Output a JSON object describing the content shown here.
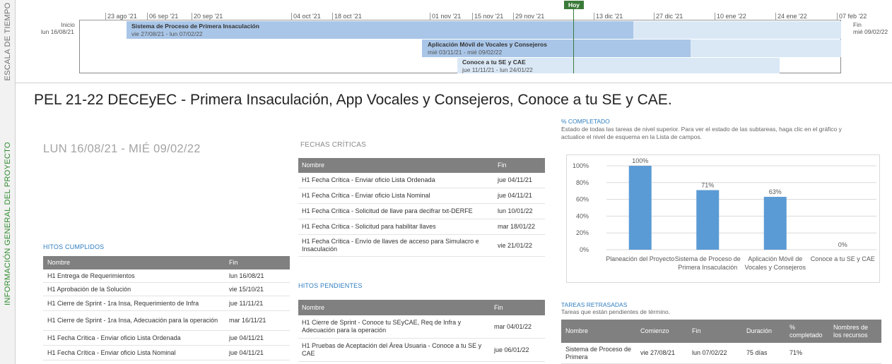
{
  "timeline": {
    "side_label": "ESCALA DE TIEMPO",
    "start": {
      "label": "Inicio",
      "date": "lun 16/08/21"
    },
    "end": {
      "label": "Fin",
      "date": "mié 09/02/22"
    },
    "today_label": "Hoy",
    "ticks": [
      "23 ago '21",
      "06 sep '21",
      "20 sep '21",
      "04 oct '21",
      "18 oct '21",
      "01 nov '21",
      "15 nov '21",
      "29 nov '21",
      "13 dic '21",
      "27 dic '21",
      "10 ene '22",
      "24 ene '22",
      "07 feb '22"
    ],
    "bars": [
      {
        "name": "Sistema de Proceso de Primera Insaculación",
        "dates": "vie 27/08/21 - lun 07/02/22",
        "progress_pct": 71
      },
      {
        "name": "Aplicación Móvil de Vocales y Consejeros",
        "dates": "mié 03/11/21 - mié 09/02/22",
        "progress_pct": 63
      },
      {
        "name": "Conoce a tu SE y CAE",
        "dates": "jue 11/11/21 - lun 24/01/22",
        "progress_pct": 0
      }
    ],
    "colors": {
      "progress": "#a9c6e8",
      "remaining": "#dae8f6",
      "today": "#3a7a38"
    }
  },
  "overview": {
    "side_label": "INFORMACIÓN GENERAL DEL PROYECTO",
    "title": "PEL 21-22 DECEyEC - Primera Insaculación, App Vocales y Consejeros, Conoce a tu SE y CAE.",
    "date_range": "LUN 16/08/21 -  MIÉ 09/02/22"
  },
  "fechas_criticas": {
    "heading": "FECHAS CRÍTICAS",
    "columns": [
      "Nombre",
      "Fin"
    ],
    "rows": [
      [
        "H1 Fecha Crítica - Enviar oficio Lista Ordenada",
        "jue 04/11/21"
      ],
      [
        "H1 Fecha Crítica - Enviar oficio Lista Nominal",
        "jue 04/11/21"
      ],
      [
        "H1 Fecha Crítica - Solicitud de llave para decifrar txt-DERFE",
        "lun 10/01/22"
      ],
      [
        "H1 Fecha Crítica - Solicitud para habilitar llaves",
        "mar 18/01/22"
      ],
      [
        "H1 Fecha Crítica - Envío de llaves de acceso para Simulacro e Insaculación",
        "vie 21/01/22"
      ]
    ]
  },
  "hitos_cumplidos": {
    "heading": "HITOS CUMPLIDOS",
    "columns": [
      "Nombre",
      "Fin"
    ],
    "rows": [
      [
        "H1 Entrega de Requerimientos",
        "lun 16/08/21"
      ],
      [
        "H1 Aprobación de la Solución",
        "vie 15/10/21"
      ],
      [
        "H1 Cierre de Sprint - 1ra Insa, Requerimiento de Infra",
        "jue 11/11/21"
      ],
      [
        "H1 Cierre de Sprint - 1ra Insa, Adecuación para la operación",
        "mar 16/11/21"
      ],
      [
        "H1 Fecha Crítica - Enviar oficio Lista Ordenada",
        "jue 04/11/21"
      ],
      [
        "H1 Fecha Crítica - Enviar oficio Lista Nominal",
        "jue 04/11/21"
      ]
    ]
  },
  "hitos_pendientes": {
    "heading": "HITOS PENDIENTES",
    "columns": [
      "Nombre",
      "Fin"
    ],
    "rows": [
      [
        "H1 Cierre de Sprint - Conoce tu SEyCAE, Req de Infra y Adecuación para la operación",
        "mar 04/01/22"
      ],
      [
        "H1 Pruebas de Aceptación del Área Usuaria - Conoce a tu SE y CAE",
        "jue 06/01/22"
      ]
    ]
  },
  "completion_chart": {
    "heading": "% COMPLETADO",
    "description": "Estado de todas las tareas de nivel superior. Para ver el estado de las subtareas, haga clic en el gráfico y actualice el nivel de esquema en la Lista de campos."
  },
  "chart_data": {
    "type": "bar",
    "categories": [
      "Planeación del Proyecto",
      "Sistema de Proceso de Primera Insaculación",
      "Aplicación Móvil de Vocales y Consejeros",
      "Conoce a tu SE y CAE"
    ],
    "category_lines": [
      [
        "Planeación del Proyecto"
      ],
      [
        "Sistema de Proceso de",
        "Primera Insaculación"
      ],
      [
        "Aplicación Móvil de",
        "Vocales y Consejeros"
      ],
      [
        "Conoce a tu SE y CAE"
      ]
    ],
    "values": [
      100,
      71,
      63,
      0
    ],
    "data_labels": [
      "100%",
      "71%",
      "63%",
      "0%"
    ],
    "ylim": [
      0,
      100
    ],
    "yticks": [
      "0%",
      "20%",
      "40%",
      "60%",
      "80%",
      "100%"
    ],
    "grid": true,
    "bar_color": "#5b9bd5"
  },
  "tareas_retrasadas": {
    "heading": "TAREAS RETRASADAS",
    "subtitle": "Tareas que están pendientes de término.",
    "columns": [
      "Nombre",
      "Comienzo",
      "Fin",
      "Duración",
      "% completado",
      "Nombres de los recursos"
    ],
    "rows": [
      [
        "Sistema de Proceso de Primera",
        "vie 27/08/21",
        "lun 07/02/22",
        "75 días",
        "71%",
        ""
      ]
    ]
  }
}
